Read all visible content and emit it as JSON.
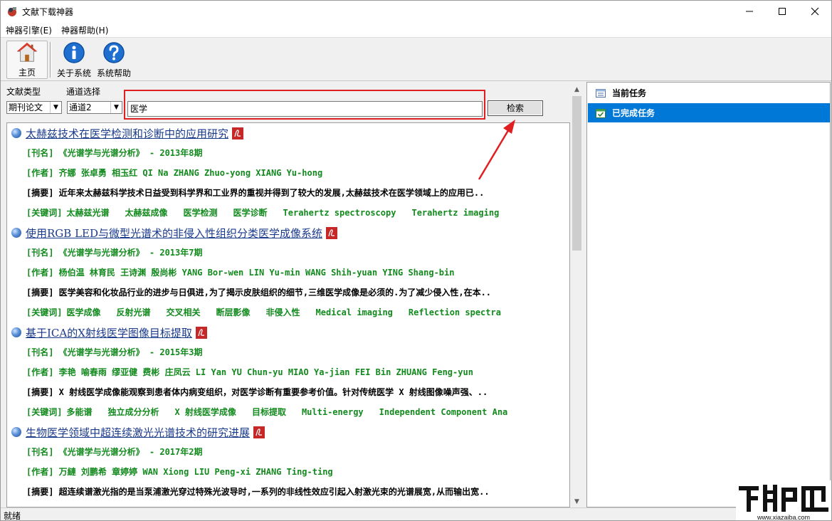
{
  "window": {
    "title": "文献下载神器"
  },
  "menu": [
    "神器引擎(E)",
    "神器帮助(H)"
  ],
  "toolbar": [
    {
      "label": "主页",
      "icon": "home-icon"
    },
    {
      "label": "关于系统",
      "icon": "info-icon"
    },
    {
      "label": "系统帮助",
      "icon": "help-icon"
    }
  ],
  "filters": {
    "type_label": "文献类型",
    "type_value": "期刊论文",
    "channel_label": "通道选择",
    "channel_value": "通道2"
  },
  "search": {
    "value": "医学",
    "button_label": "检索"
  },
  "articles": [
    {
      "title": "太赫兹技术在医学检测和诊断中的应用研究",
      "journal": "[刊名] 《光谱学与光谱分析》 - 2013年8期",
      "authors": "[作者] 齐娜 张卓勇 相玉红 QI Na ZHANG Zhuo-yong XIANG Yu-hong",
      "abstract": "[摘要] 近年来太赫兹科学技术日益受到科学界和工业界的重视并得到了较大的发展,太赫兹技术在医学领域上的应用已..",
      "keywords_prefix": "[关键词]",
      "keywords": [
        "太赫兹光谱",
        "太赫兹成像",
        "医学检测",
        "医学诊断",
        "Terahertz spectroscopy",
        "Terahertz imaging"
      ]
    },
    {
      "title": "使用RGB LED与微型光谱术的非侵入性组织分类医学成像系统",
      "journal": "[刊名] 《光谱学与光谱分析》 - 2013年7期",
      "authors": "[作者] 杨伯温 林育民 王诗渊 殷尚彬 YANG Bor-wen LIN Yu-min WANG Shih-yuan YING Shang-bin",
      "abstract": "[摘要] 医学美容和化妆品行业的进步与日俱进,为了揭示皮肤组织的细节,三维医学成像是必须的.为了减少侵入性,在本..",
      "keywords_prefix": "[关键词]",
      "keywords": [
        "医学成像",
        "反射光谱",
        "交叉相关",
        "断层影像",
        "非侵入性",
        "Medical imaging",
        "Reflection spectra"
      ]
    },
    {
      "title": "基于ICA的X射线医学图像目标提取",
      "journal": "[刊名] 《光谱学与光谱分析》 - 2015年3期",
      "authors": "[作者] 李艳 喻春雨 缪亚健 费彬 庄凤云 LI Yan YU Chun-yu MIAO Ya-jian FEI Bin ZHUANG Feng-yun",
      "abstract": "[摘要] X 射线医学成像能观察到患者体内病变组织，对医学诊断有重要参考价值。针对传统医学 X 射线图像噪声强、..",
      "keywords_prefix": "[关键词]",
      "keywords": [
        "多能谱",
        "独立成分分析",
        "X 射线医学成像",
        "目标提取",
        "Multi-energy",
        "Independent Component Ana"
      ]
    },
    {
      "title": "生物医学领域中超连续激光光谱技术的研究进展",
      "journal": "[刊名] 《光谱学与光谱分析》 - 2017年2期",
      "authors": "[作者] 万縺 刘鹏希 章婷婷 WAN Xiong LIU Peng-xi ZHANG Ting-ting",
      "abstract": "[摘要] 超连续谱激光指的是当泵浦激光穿过特殊光波导时,一系列的非线性效应引起入射激光束的光谱展宽,从而输出宽..",
      "keywords_prefix": "",
      "keywords": []
    }
  ],
  "tasks": [
    {
      "label": "当前任务",
      "icon": "list-icon"
    },
    {
      "label": "已完成任务",
      "icon": "calendar-check-icon"
    }
  ],
  "status": {
    "text": "就绪"
  },
  "colors": {
    "link": "#1a3a8c",
    "green_text": "#138a1e",
    "selection": "#0078d7",
    "highlight_box": "#e02020"
  }
}
